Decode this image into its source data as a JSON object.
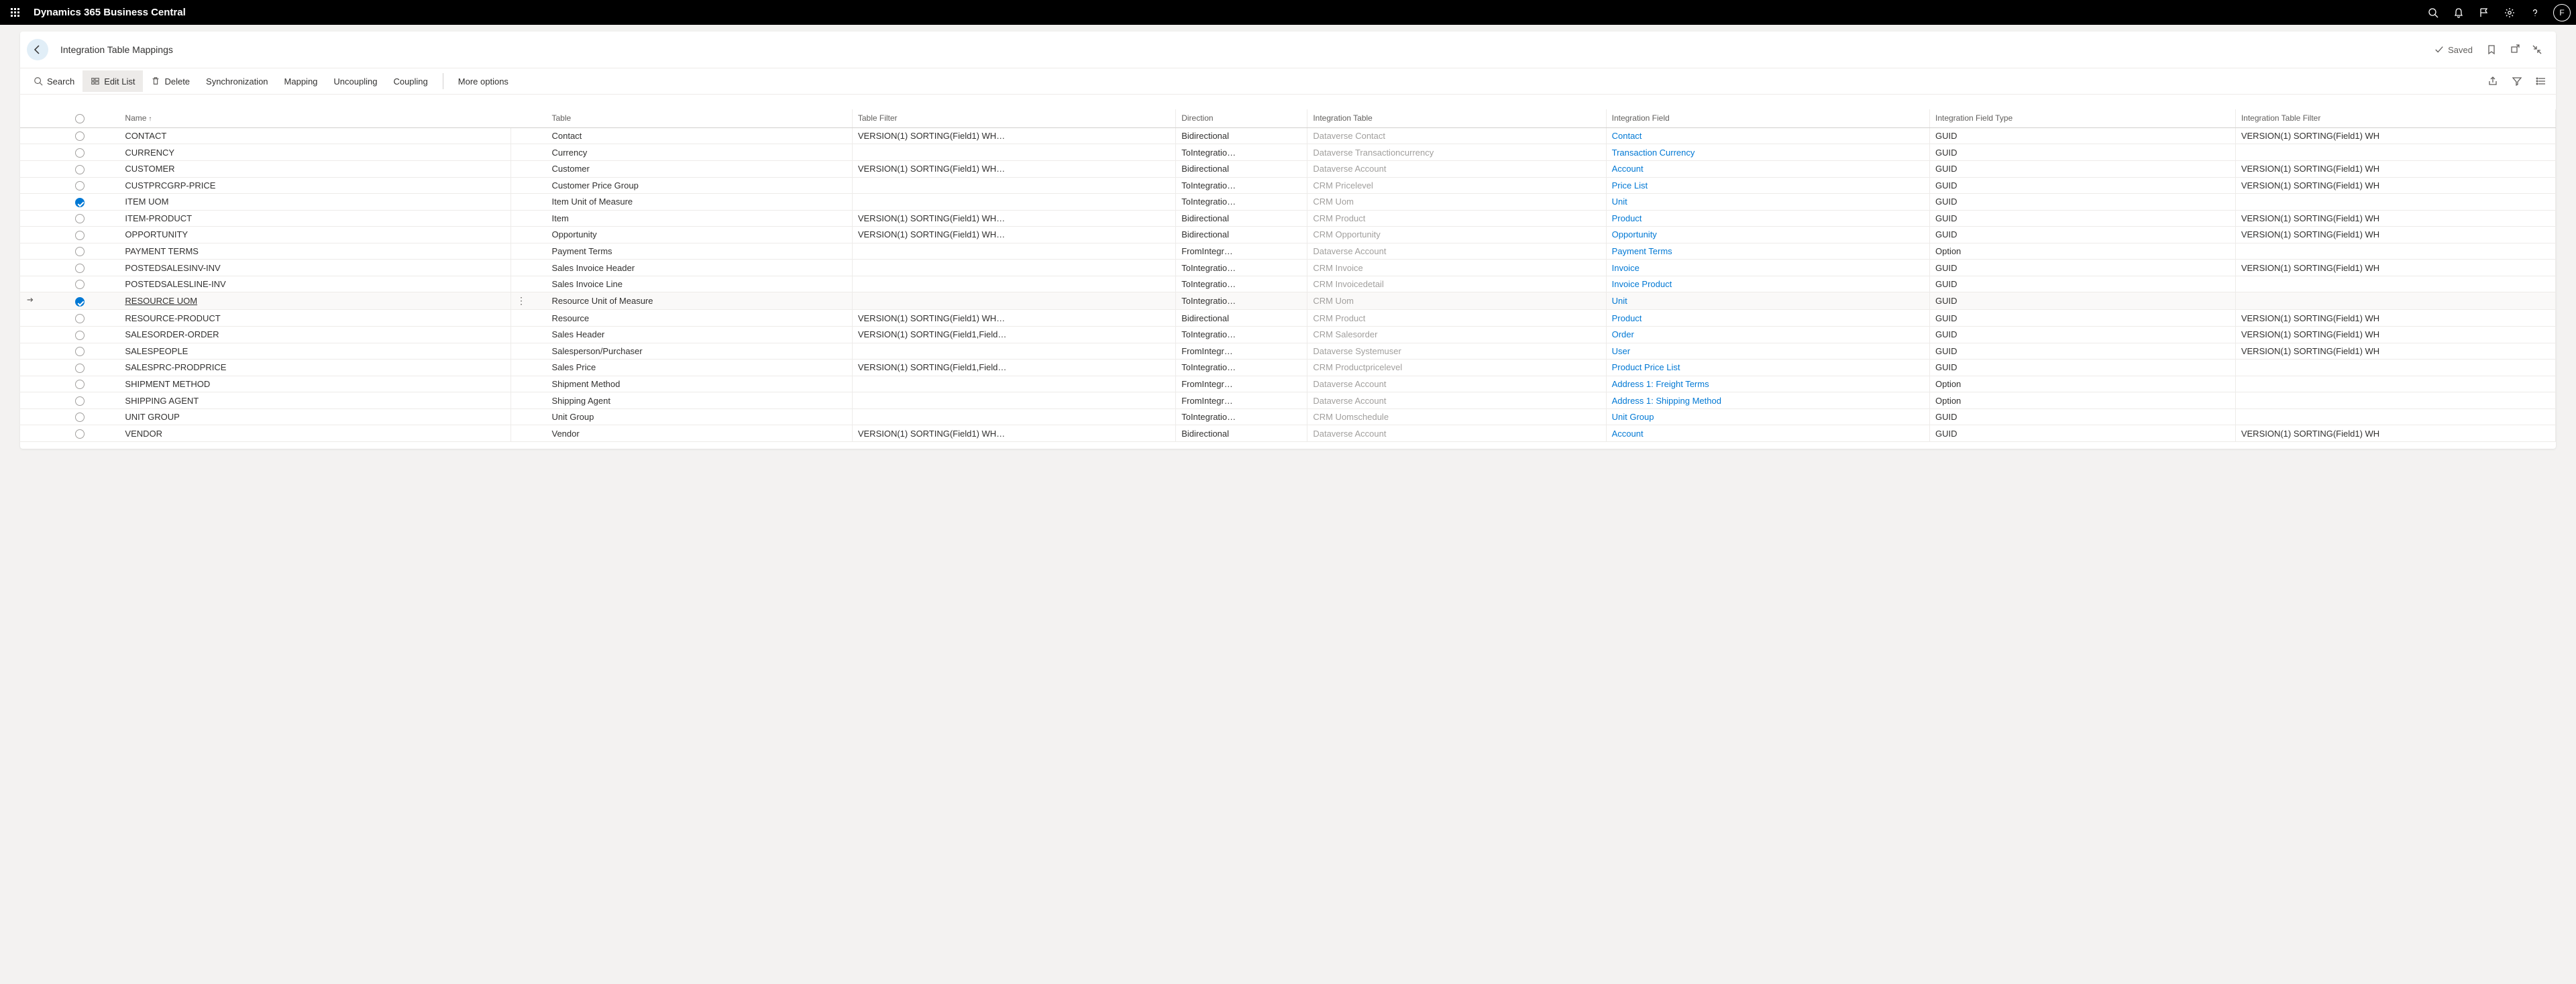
{
  "header": {
    "app_title": "Dynamics 365 Business Central",
    "avatar_initial": "F"
  },
  "titlebar": {
    "page_title": "Integration Table Mappings",
    "saved_label": "Saved"
  },
  "toolbar": {
    "search": "Search",
    "edit_list": "Edit List",
    "delete": "Delete",
    "synchronization": "Synchronization",
    "mapping": "Mapping",
    "uncoupling": "Uncoupling",
    "coupling": "Coupling",
    "more_options": "More options"
  },
  "columns": {
    "name": "Name",
    "table": "Table",
    "table_filter": "Table Filter",
    "direction": "Direction",
    "integration_table": "Integration Table",
    "integration_field": "Integration Field",
    "integration_field_type": "Integration Field Type",
    "integration_table_filter": "Integration Table Filter"
  },
  "rows": [
    {
      "selected": false,
      "current": false,
      "name": "CONTACT",
      "table": "Contact",
      "table_filter": "VERSION(1) SORTING(Field1) WH…",
      "direction": "Bidirectional",
      "integration_table": "Dataverse Contact",
      "integration_field": "Contact",
      "integration_field_type": "GUID",
      "integration_table_filter": "VERSION(1) SORTING(Field1) WH"
    },
    {
      "selected": false,
      "current": false,
      "name": "CURRENCY",
      "table": "Currency",
      "table_filter": "",
      "direction": "ToIntegratio…",
      "integration_table": "Dataverse Transactioncurrency",
      "integration_field": "Transaction Currency",
      "integration_field_type": "GUID",
      "integration_table_filter": ""
    },
    {
      "selected": false,
      "current": false,
      "name": "CUSTOMER",
      "table": "Customer",
      "table_filter": "VERSION(1) SORTING(Field1) WH…",
      "direction": "Bidirectional",
      "integration_table": "Dataverse Account",
      "integration_field": "Account",
      "integration_field_type": "GUID",
      "integration_table_filter": "VERSION(1) SORTING(Field1) WH"
    },
    {
      "selected": false,
      "current": false,
      "name": "CUSTPRCGRP-PRICE",
      "table": "Customer Price Group",
      "table_filter": "",
      "direction": "ToIntegratio…",
      "integration_table": "CRM Pricelevel",
      "integration_field": "Price List",
      "integration_field_type": "GUID",
      "integration_table_filter": "VERSION(1) SORTING(Field1) WH"
    },
    {
      "selected": true,
      "current": false,
      "name": "ITEM UOM",
      "table": "Item Unit of Measure",
      "table_filter": "",
      "direction": "ToIntegratio…",
      "integration_table": "CRM Uom",
      "integration_field": "Unit",
      "integration_field_type": "GUID",
      "integration_table_filter": ""
    },
    {
      "selected": false,
      "current": false,
      "name": "ITEM-PRODUCT",
      "table": "Item",
      "table_filter": "VERSION(1) SORTING(Field1) WH…",
      "direction": "Bidirectional",
      "integration_table": "CRM Product",
      "integration_field": "Product",
      "integration_field_type": "GUID",
      "integration_table_filter": "VERSION(1) SORTING(Field1) WH"
    },
    {
      "selected": false,
      "current": false,
      "name": "OPPORTUNITY",
      "table": "Opportunity",
      "table_filter": "VERSION(1) SORTING(Field1) WH…",
      "direction": "Bidirectional",
      "integration_table": "CRM Opportunity",
      "integration_field": "Opportunity",
      "integration_field_type": "GUID",
      "integration_table_filter": "VERSION(1) SORTING(Field1) WH"
    },
    {
      "selected": false,
      "current": false,
      "name": "PAYMENT TERMS",
      "table": "Payment Terms",
      "table_filter": "",
      "direction": "FromIntegr…",
      "integration_table": "Dataverse Account",
      "integration_field": "Payment Terms",
      "integration_field_type": "Option",
      "integration_table_filter": ""
    },
    {
      "selected": false,
      "current": false,
      "name": "POSTEDSALESINV-INV",
      "table": "Sales Invoice Header",
      "table_filter": "",
      "direction": "ToIntegratio…",
      "integration_table": "CRM Invoice",
      "integration_field": "Invoice",
      "integration_field_type": "GUID",
      "integration_table_filter": "VERSION(1) SORTING(Field1) WH"
    },
    {
      "selected": false,
      "current": false,
      "name": "POSTEDSALESLINE-INV",
      "table": "Sales Invoice Line",
      "table_filter": "",
      "direction": "ToIntegratio…",
      "integration_table": "CRM Invoicedetail",
      "integration_field": "Invoice Product",
      "integration_field_type": "GUID",
      "integration_table_filter": ""
    },
    {
      "selected": true,
      "current": true,
      "name": "RESOURCE UOM",
      "table": "Resource Unit of Measure",
      "table_filter": "",
      "direction": "ToIntegratio…",
      "integration_table": "CRM Uom",
      "integration_field": "Unit",
      "integration_field_type": "GUID",
      "integration_table_filter": ""
    },
    {
      "selected": false,
      "current": false,
      "name": "RESOURCE-PRODUCT",
      "table": "Resource",
      "table_filter": "VERSION(1) SORTING(Field1) WH…",
      "direction": "Bidirectional",
      "integration_table": "CRM Product",
      "integration_field": "Product",
      "integration_field_type": "GUID",
      "integration_table_filter": "VERSION(1) SORTING(Field1) WH"
    },
    {
      "selected": false,
      "current": false,
      "name": "SALESORDER-ORDER",
      "table": "Sales Header",
      "table_filter": "VERSION(1) SORTING(Field1,Field…",
      "direction": "ToIntegratio…",
      "integration_table": "CRM Salesorder",
      "integration_field": "Order",
      "integration_field_type": "GUID",
      "integration_table_filter": "VERSION(1) SORTING(Field1) WH"
    },
    {
      "selected": false,
      "current": false,
      "name": "SALESPEOPLE",
      "table": "Salesperson/Purchaser",
      "table_filter": "",
      "direction": "FromIntegr…",
      "integration_table": "Dataverse Systemuser",
      "integration_field": "User",
      "integration_field_type": "GUID",
      "integration_table_filter": "VERSION(1) SORTING(Field1) WH"
    },
    {
      "selected": false,
      "current": false,
      "name": "SALESPRC-PRODPRICE",
      "table": "Sales Price",
      "table_filter": "VERSION(1) SORTING(Field1,Field…",
      "direction": "ToIntegratio…",
      "integration_table": "CRM Productpricelevel",
      "integration_field": "Product Price List",
      "integration_field_type": "GUID",
      "integration_table_filter": ""
    },
    {
      "selected": false,
      "current": false,
      "name": "SHIPMENT METHOD",
      "table": "Shipment Method",
      "table_filter": "",
      "direction": "FromIntegr…",
      "integration_table": "Dataverse Account",
      "integration_field": "Address 1: Freight Terms",
      "integration_field_type": "Option",
      "integration_table_filter": ""
    },
    {
      "selected": false,
      "current": false,
      "name": "SHIPPING AGENT",
      "table": "Shipping Agent",
      "table_filter": "",
      "direction": "FromIntegr…",
      "integration_table": "Dataverse Account",
      "integration_field": "Address 1: Shipping Method",
      "integration_field_type": "Option",
      "integration_table_filter": ""
    },
    {
      "selected": false,
      "current": false,
      "name": "UNIT GROUP",
      "table": "Unit Group",
      "table_filter": "",
      "direction": "ToIntegratio…",
      "integration_table": "CRM Uomschedule",
      "integration_field": "Unit Group",
      "integration_field_type": "GUID",
      "integration_table_filter": ""
    },
    {
      "selected": false,
      "current": false,
      "name": "VENDOR",
      "table": "Vendor",
      "table_filter": "VERSION(1) SORTING(Field1) WH…",
      "direction": "Bidirectional",
      "integration_table": "Dataverse Account",
      "integration_field": "Account",
      "integration_field_type": "GUID",
      "integration_table_filter": "VERSION(1) SORTING(Field1) WH"
    }
  ]
}
